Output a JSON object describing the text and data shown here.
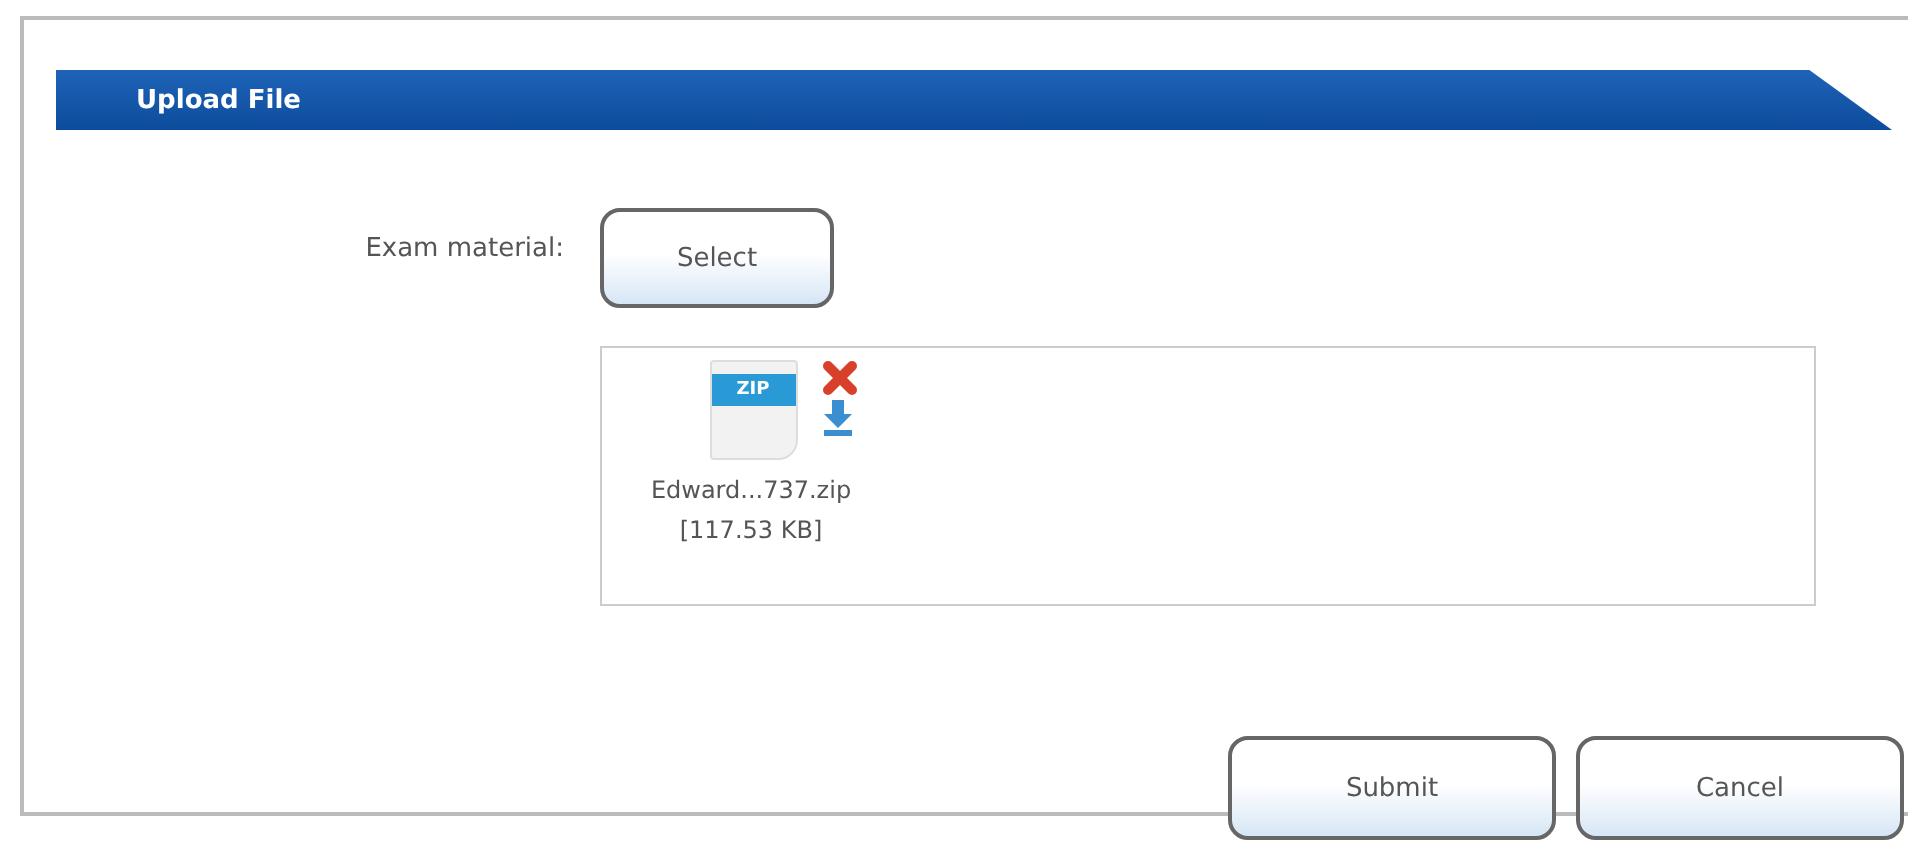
{
  "header": {
    "title": "Upload File"
  },
  "field": {
    "label": "Exam material:",
    "button": "Select"
  },
  "files": [
    {
      "badge": "ZIP",
      "name": "Edward...737.zip",
      "size": "[117.53 KB]"
    }
  ],
  "buttons": [
    "Submit",
    "Cancel"
  ]
}
